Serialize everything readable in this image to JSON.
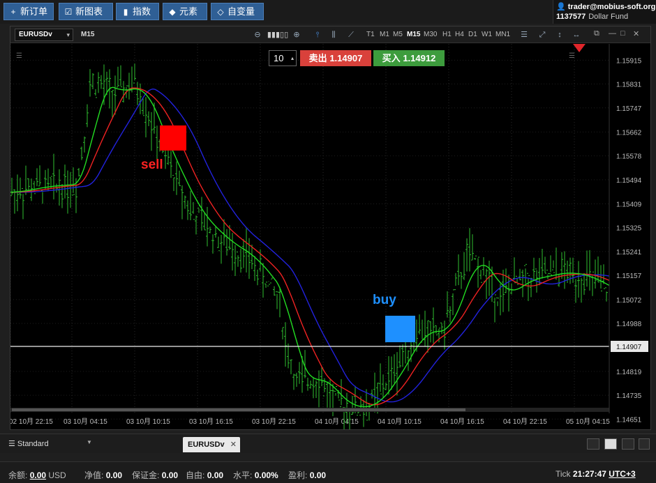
{
  "toolbar": {
    "buttons": [
      {
        "icon": "plus-icon",
        "glyph": "+",
        "label": "新订单"
      },
      {
        "icon": "chart-check-icon",
        "glyph": "☑",
        "label": "新图表"
      },
      {
        "icon": "bar-chart-icon",
        "glyph": "▮",
        "label": "指数"
      },
      {
        "icon": "shapes-icon",
        "glyph": "◆",
        "label": "元素"
      },
      {
        "icon": "diamond-icon",
        "glyph": "◇",
        "label": "自变量"
      }
    ]
  },
  "account": {
    "user": "trader@mobius-soft.org",
    "id": "1137577",
    "fund": "Dollar Fund"
  },
  "chart_toolbar": {
    "symbol": "EURUSDv",
    "timeframe": "M15",
    "timeframes": [
      "T1",
      "M1",
      "M5",
      "M15",
      "M30",
      "H1",
      "H4",
      "D1",
      "W1",
      "MN1"
    ],
    "active_timeframe": "M15"
  },
  "trade": {
    "lot": "10",
    "sell_label": "卖出",
    "sell_price": "1.14907",
    "buy_label": "买入",
    "buy_price": "1.14912"
  },
  "annotations": {
    "sell": "sell",
    "buy": "buy"
  },
  "chart_data": {
    "type": "line",
    "symbol": "EURUSDv",
    "timeframe": "M15",
    "y_ticks": [
      "1.15915",
      "1.15831",
      "1.15747",
      "1.15662",
      "1.15578",
      "1.15494",
      "1.15409",
      "1.15325",
      "1.15241",
      "1.15157",
      "1.15072",
      "1.14988",
      "1.14907",
      "1.14819",
      "1.14735",
      "1.14651"
    ],
    "ylim": [
      1.1461,
      1.1596
    ],
    "current_price": "1.14907",
    "x_ticks": [
      "02 10月 22:15",
      "03 10月 04:15",
      "03 10月 10:15",
      "03 10月 16:15",
      "03 10月 22:15",
      "04 10月 04:15",
      "04 10月 10:15",
      "04 10月 16:15",
      "04 10月 22:15",
      "05 10月 04:15"
    ],
    "series": [],
    "colors": {
      "fast": "#22dd22",
      "mid": "#ee2222",
      "slow": "#2222dd",
      "bars": "#2fbf2f",
      "sell": "#ff0000",
      "buy": "#1e90ff"
    }
  },
  "tabs": {
    "profile": "Standard",
    "chart_tab": "EURUSDv"
  },
  "status": {
    "balance_label": "余额:",
    "balance": "0.00",
    "currency": "USD",
    "equity_label": "净值:",
    "equity": "0.00",
    "margin_label": "保证金:",
    "margin": "0.00",
    "free_label": "自由:",
    "free": "0.00",
    "level_label": "水平:",
    "level": "0.00%",
    "profit_label": "盈利:",
    "profit": "0.00",
    "tick_label": "Tick",
    "time": "21:27:47",
    "tz": "UTC+3"
  }
}
